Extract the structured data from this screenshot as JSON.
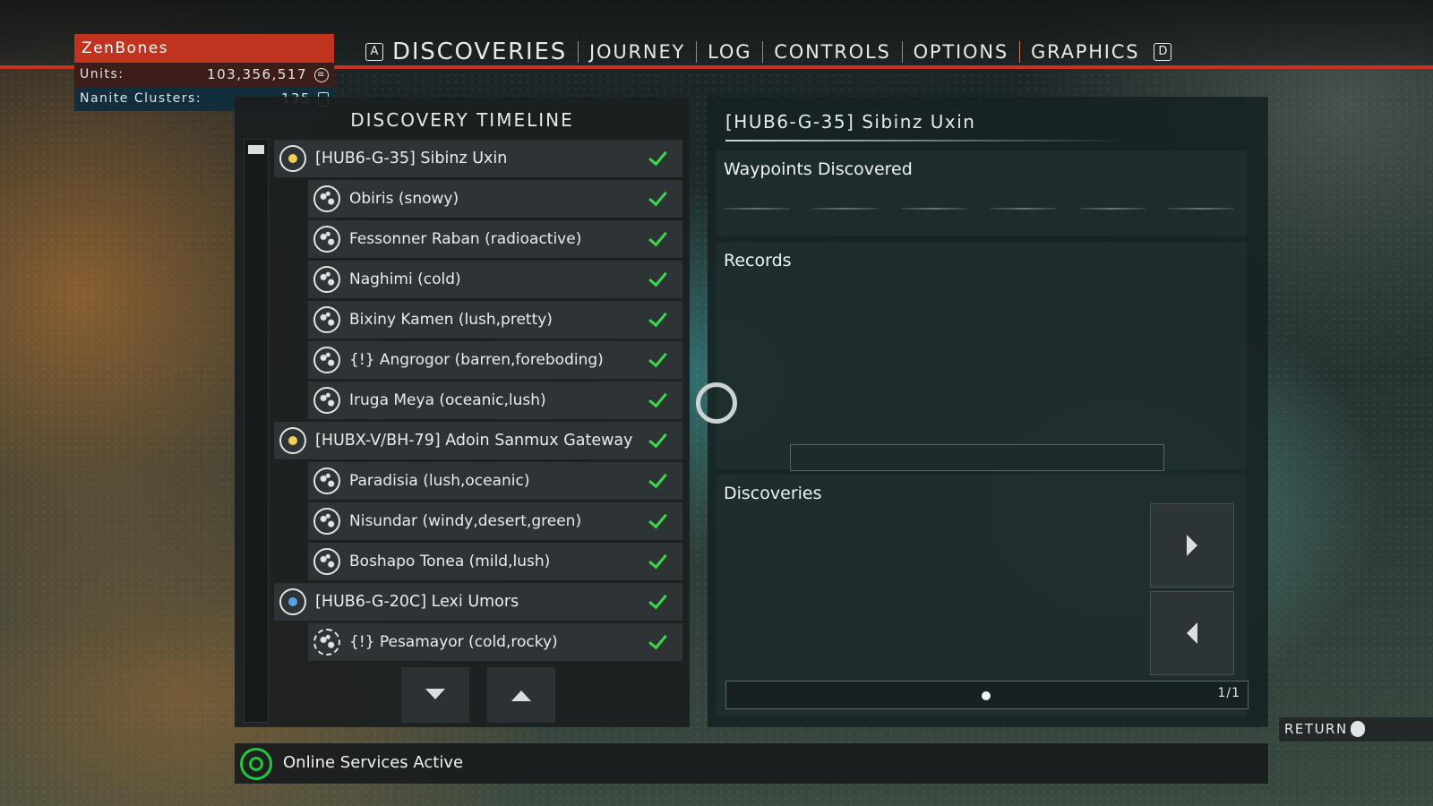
{
  "player": {
    "name": "ZenBones",
    "units_label": "Units:",
    "units_value": "103,356,517",
    "nanites_label": "Nanite Clusters:",
    "nanites_value": "135"
  },
  "nav": {
    "left_key": "A",
    "right_key": "D",
    "tabs": [
      "DISCOVERIES",
      "JOURNEY",
      "LOG",
      "CONTROLS",
      "OPTIONS",
      "GRAPHICS"
    ],
    "active_tab": "DISCOVERIES"
  },
  "timeline": {
    "title": "DISCOVERY TIMELINE",
    "items": [
      {
        "label": "[HUB6-G-35] Sibinz Uxin",
        "type": "system",
        "star": "yellow",
        "checked": true
      },
      {
        "label": "Obiris (snowy)",
        "type": "planet",
        "checked": true
      },
      {
        "label": "Fessonner Raban (radioactive)",
        "type": "planet",
        "checked": true
      },
      {
        "label": "Naghimi (cold)",
        "type": "planet",
        "checked": true
      },
      {
        "label": "Bixiny Kamen (lush,pretty)",
        "type": "planet",
        "checked": true
      },
      {
        "label": "{!} Angrogor (barren,foreboding)",
        "type": "planet",
        "checked": true
      },
      {
        "label": "Iruga Meya (oceanic,lush)",
        "type": "planet",
        "checked": true
      },
      {
        "label": "[HUBX-V/BH-79] Adoin Sanmux Gateway",
        "type": "system",
        "star": "yellow",
        "checked": true
      },
      {
        "label": "Paradisia (lush,oceanic)",
        "type": "planet",
        "checked": true
      },
      {
        "label": "Nisundar (windy,desert,green)",
        "type": "planet",
        "checked": true
      },
      {
        "label": "Boshapo Tonea (mild,lush)",
        "type": "planet",
        "checked": true
      },
      {
        "label": "[HUB6-G-20C] Lexi Umors",
        "type": "system",
        "star": "blue",
        "checked": true
      },
      {
        "label": "{!} Pesamayor (cold,rocky)",
        "type": "planet-dashed",
        "checked": true
      }
    ]
  },
  "detail": {
    "title": "[HUB6-G-35] Sibinz Uxin",
    "waypoints_title": "Waypoints Discovered",
    "records_title": "Records",
    "discoveries_title": "Discoveries",
    "page_indicator": "1/1"
  },
  "status": {
    "online_text": "Online Services Active"
  },
  "return_label": "RETURN",
  "colors": {
    "accent_red": "#c0331f",
    "check_green": "#39d94a",
    "online_green": "#22c640"
  }
}
